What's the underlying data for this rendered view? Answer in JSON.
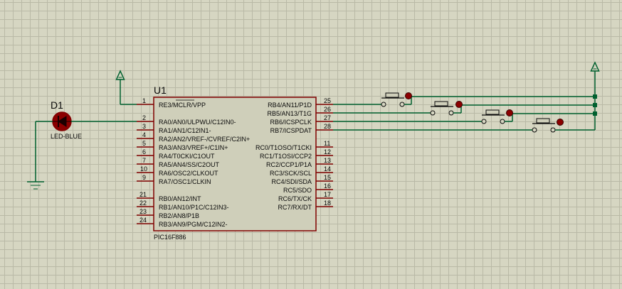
{
  "chip": {
    "ref": "U1",
    "part": "PIC16F886",
    "left_pins": [
      {
        "num": "1",
        "label": "RE3/MCLR/VPP"
      },
      {
        "num": "2",
        "label": "RA0/AN0/ULPWU/C12IN0-"
      },
      {
        "num": "3",
        "label": "RA1/AN1/C12IN1-"
      },
      {
        "num": "4",
        "label": "RA2/AN2/VREF-/CVREF/C2IN+"
      },
      {
        "num": "5",
        "label": "RA3/AN3/VREF+/C1IN+"
      },
      {
        "num": "6",
        "label": "RA4/T0CKI/C1OUT"
      },
      {
        "num": "7",
        "label": "RA5/AN4/SS/C2OUT"
      },
      {
        "num": "10",
        "label": "RA6/OSC2/CLKOUT"
      },
      {
        "num": "9",
        "label": "RA7/OSC1/CLKIN"
      },
      {
        "num": "21",
        "label": "RB0/AN12/INT"
      },
      {
        "num": "22",
        "label": "RB1/AN10/P1C/C12IN3-"
      },
      {
        "num": "23",
        "label": "RB2/AN8/P1B"
      },
      {
        "num": "24",
        "label": "RB3/AN9/PGM/C12IN2-"
      }
    ],
    "right_pins": [
      {
        "num": "25",
        "label": "RB4/AN11/P1D"
      },
      {
        "num": "26",
        "label": "RB5/AN13/T1G"
      },
      {
        "num": "27",
        "label": "RB6/ICSPCLK"
      },
      {
        "num": "28",
        "label": "RB7/ICSPDAT"
      },
      {
        "num": "11",
        "label": "RC0/T1OSO/T1CKI"
      },
      {
        "num": "12",
        "label": "RC1/T1OSI/CCP2"
      },
      {
        "num": "13",
        "label": "RC2/CCP1/P1A"
      },
      {
        "num": "14",
        "label": "RC3/SCK/SCL"
      },
      {
        "num": "15",
        "label": "RC4/SDI/SDA"
      },
      {
        "num": "16",
        "label": "RC5/SDO"
      },
      {
        "num": "17",
        "label": "RC6/TX/CK"
      },
      {
        "num": "18",
        "label": "RC7/RX/DT"
      }
    ]
  },
  "led": {
    "ref": "D1",
    "part": "LED-BLUE"
  },
  "colors": {
    "wire": "#00602f",
    "component": "#800000",
    "chip_fill": "#cfcfba",
    "led_fill": "#8b0000"
  }
}
